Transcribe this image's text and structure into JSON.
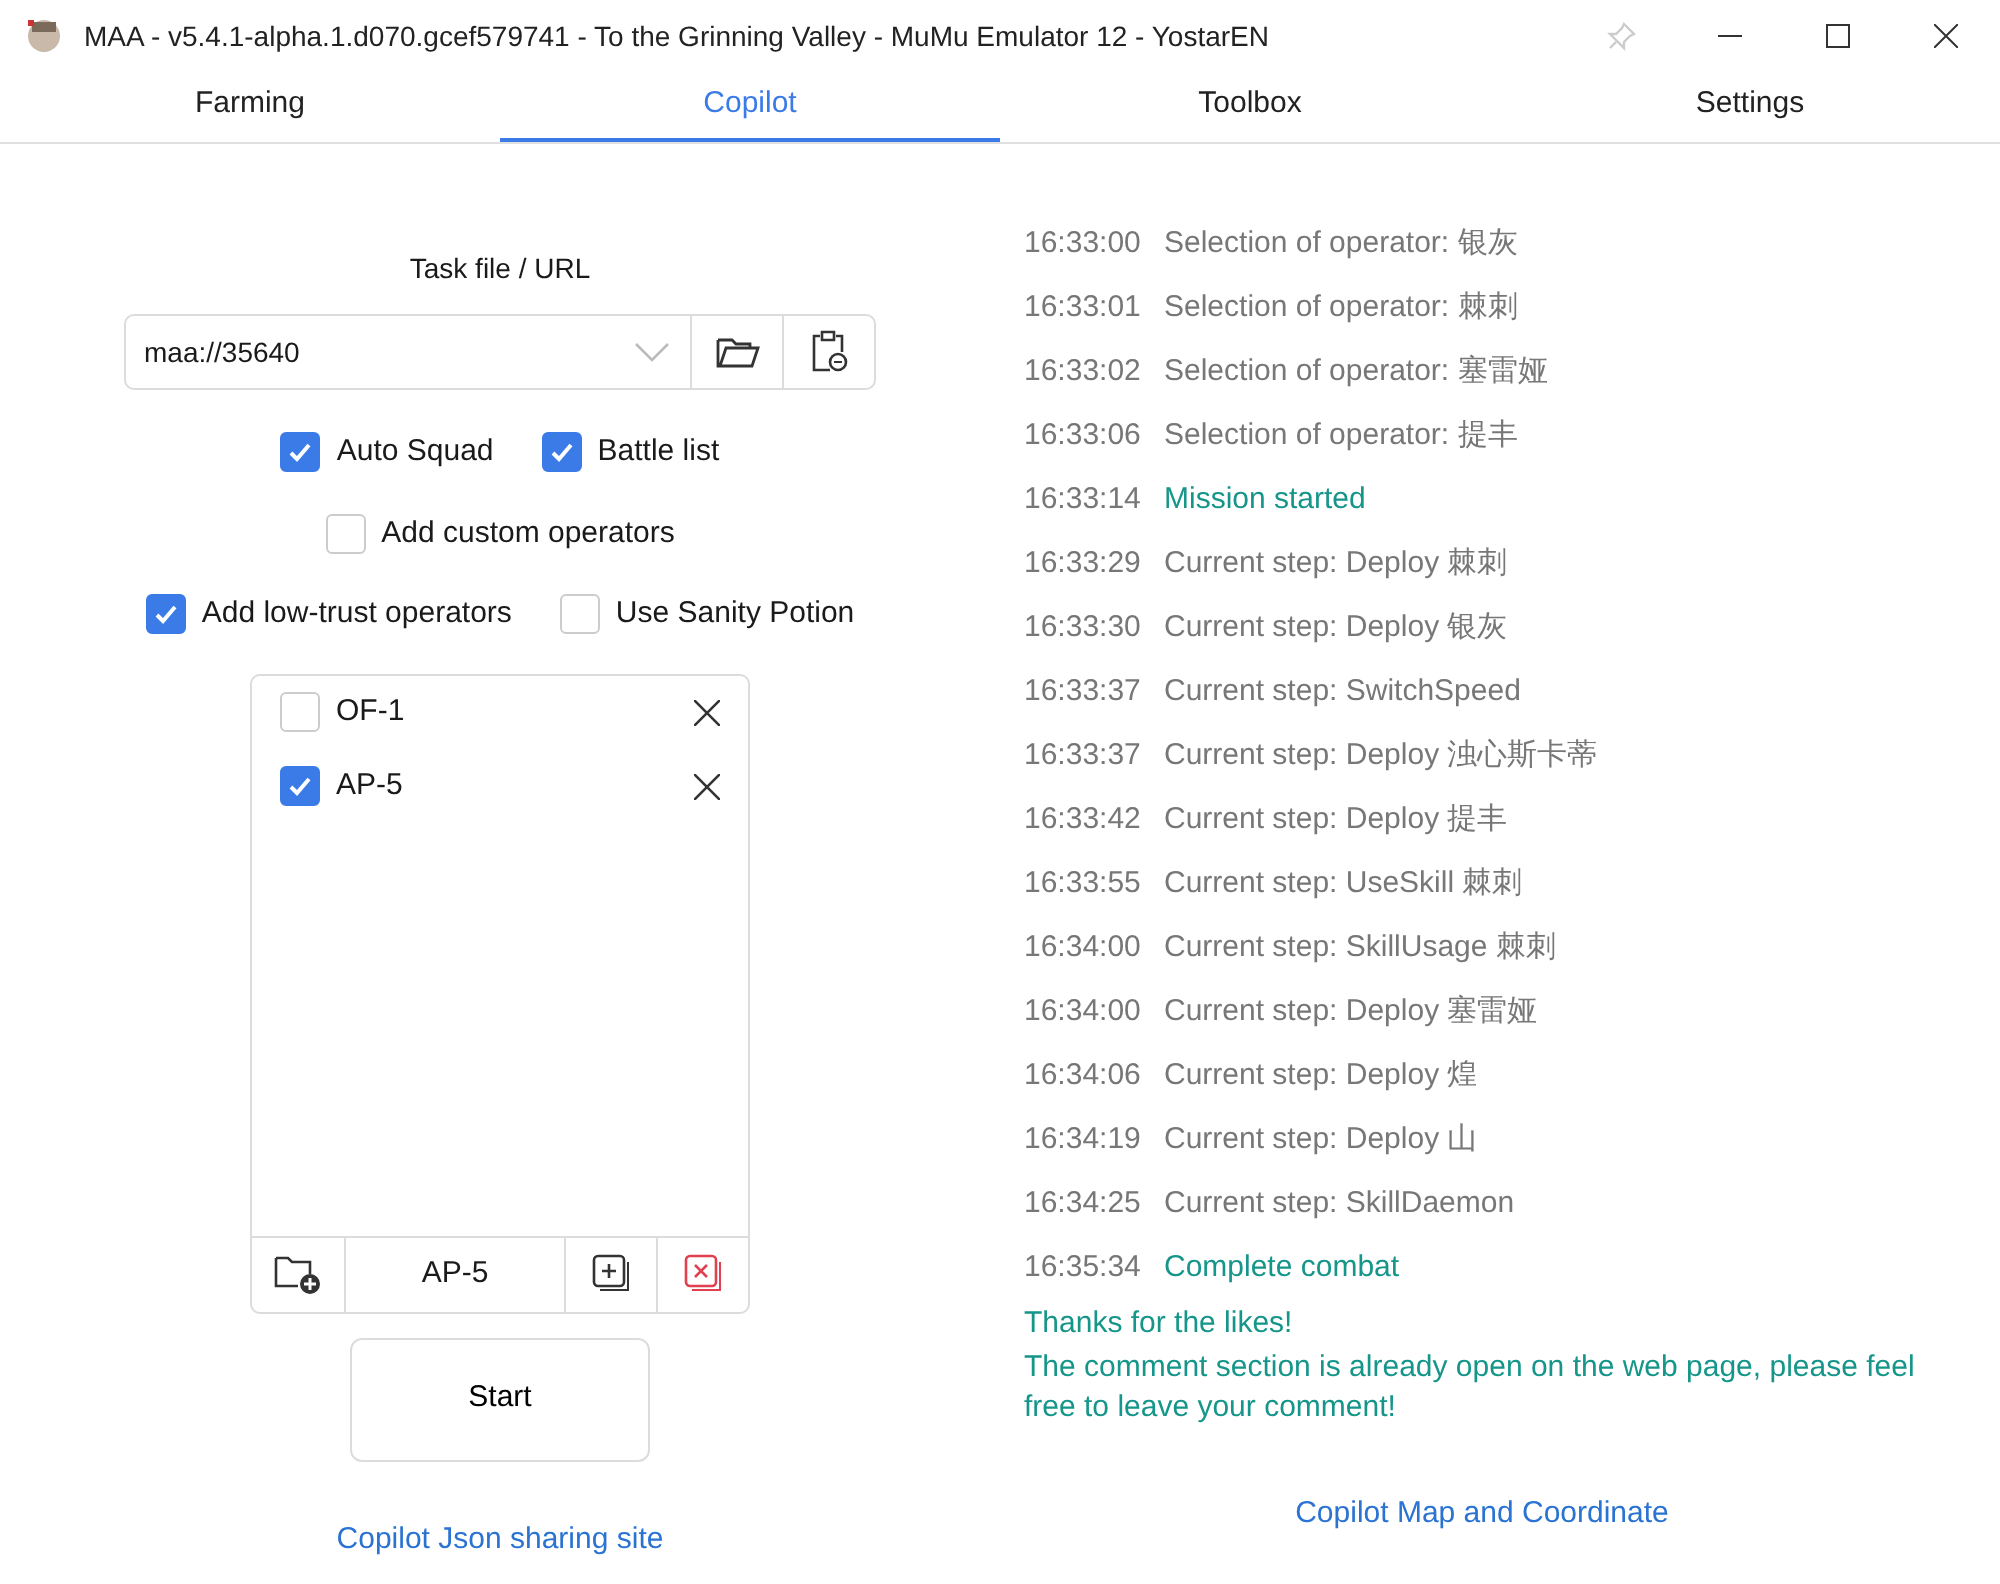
{
  "window": {
    "title": "MAA - v5.4.1-alpha.1.d070.gcef579741 - To the Grinning Valley - MuMu Emulator 12 - YostarEN"
  },
  "tabs": [
    {
      "label": "Farming",
      "selected": false
    },
    {
      "label": "Copilot",
      "selected": true
    },
    {
      "label": "Toolbox",
      "selected": false
    },
    {
      "label": "Settings",
      "selected": false
    }
  ],
  "task_file": {
    "label": "Task file / URL",
    "value": "maa://35640"
  },
  "option_rows": [
    [
      {
        "label": "Auto Squad",
        "checked": true
      },
      {
        "label": "Battle list",
        "checked": true
      }
    ],
    [
      {
        "label": "Add custom operators",
        "checked": false
      }
    ],
    [
      {
        "label": "Add low-trust operators",
        "checked": true
      },
      {
        "label": "Use Sanity Potion",
        "checked": false
      }
    ]
  ],
  "stage_list": {
    "items": [
      {
        "label": "OF-1",
        "checked": false
      },
      {
        "label": "AP-5",
        "checked": true
      }
    ],
    "stage_name": "AP-5"
  },
  "start_button": "Start",
  "left_link": "Copilot Json sharing site",
  "log": [
    {
      "time": "16:33:00",
      "text": "Selection of operator: 银灰",
      "kind": "info"
    },
    {
      "time": "16:33:01",
      "text": "Selection of operator: 棘刺",
      "kind": "info"
    },
    {
      "time": "16:33:02",
      "text": "Selection of operator: 塞雷娅",
      "kind": "info"
    },
    {
      "time": "16:33:06",
      "text": "Selection of operator: 提丰",
      "kind": "info"
    },
    {
      "time": "16:33:14",
      "text": "Mission started",
      "kind": "success"
    },
    {
      "time": "16:33:29",
      "text": "Current step: Deploy 棘刺",
      "kind": "info"
    },
    {
      "time": "16:33:30",
      "text": "Current step: Deploy 银灰",
      "kind": "info"
    },
    {
      "time": "16:33:37",
      "text": "Current step: SwitchSpeed",
      "kind": "info"
    },
    {
      "time": "16:33:37",
      "text": "Current step: Deploy 浊心斯卡蒂",
      "kind": "info"
    },
    {
      "time": "16:33:42",
      "text": "Current step: Deploy 提丰",
      "kind": "info"
    },
    {
      "time": "16:33:55",
      "text": "Current step: UseSkill 棘刺",
      "kind": "info"
    },
    {
      "time": "16:34:00",
      "text": "Current step: SkillUsage 棘刺",
      "kind": "info"
    },
    {
      "time": "16:34:00",
      "text": "Current step: Deploy 塞雷娅",
      "kind": "info"
    },
    {
      "time": "16:34:06",
      "text": "Current step: Deploy 煌",
      "kind": "info"
    },
    {
      "time": "16:34:19",
      "text": "Current step: Deploy 山",
      "kind": "info"
    },
    {
      "time": "16:34:25",
      "text": "Current step: SkillDaemon",
      "kind": "info"
    },
    {
      "time": "16:35:34",
      "text": "Complete combat",
      "kind": "success"
    }
  ],
  "log_message": [
    "Thanks for the likes!",
    "The comment section is already open on the web page, please feel free to leave your comment!"
  ],
  "right_link": "Copilot Map and Coordinate"
}
